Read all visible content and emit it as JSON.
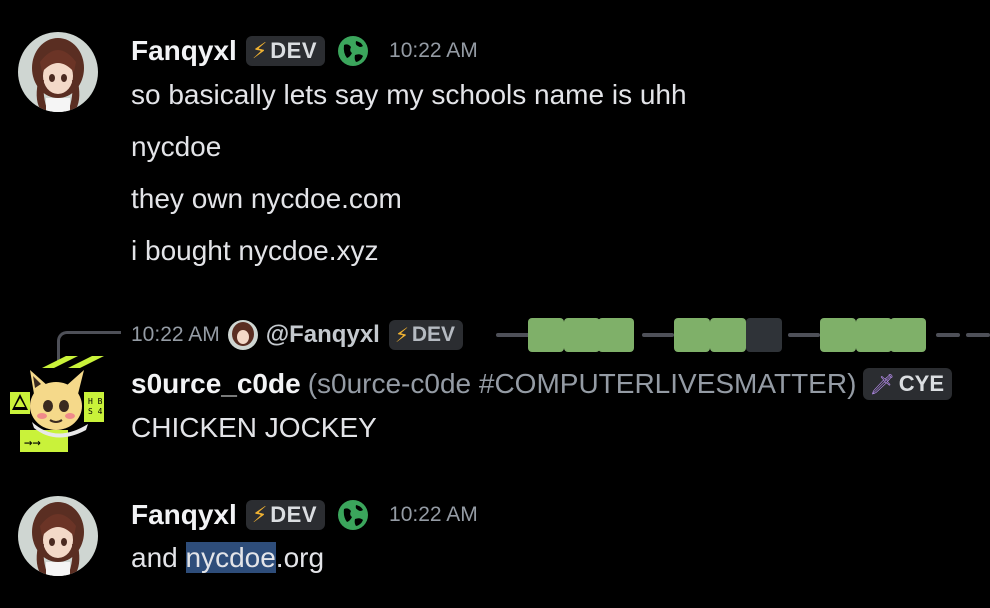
{
  "messages": [
    {
      "username": "Fanqyxl",
      "tag": "DEV",
      "timestamp": "10:22 AM",
      "lines": [
        "so basically lets say my schools name is uhh",
        "nycdoe",
        "they own nycdoe.com",
        "i bought nycdoe.xyz"
      ]
    },
    {
      "reply": {
        "timestamp": "10:22 AM",
        "mention": "@Fanqyxl",
        "tag": "DEV"
      },
      "username": "s0urce_c0de",
      "detail": "(s0urce-c0de #COMPUTERLIVESMATTER)",
      "tag": "CYE",
      "lines": [
        "CHICKEN JOCKEY"
      ]
    },
    {
      "username": "Fanqyxl",
      "tag": "DEV",
      "timestamp": "10:22 AM",
      "text_before": "and ",
      "text_highlight": "nycdoe",
      "text_after": ".org"
    }
  ],
  "icons": {
    "dev_tag": "lightning-bolt-icon",
    "globe": "globe-icon",
    "cyber_tag": "sword-icon"
  },
  "colors": {
    "background": "#000000",
    "username": "#f2f3f5",
    "timestamp": "#949ba4",
    "tag_bg": "#2b2d31",
    "bolt": "#f0b232",
    "globe": "#3ba55c",
    "nameplate_green": "#7fb069",
    "selection": "#2e4d7a"
  }
}
